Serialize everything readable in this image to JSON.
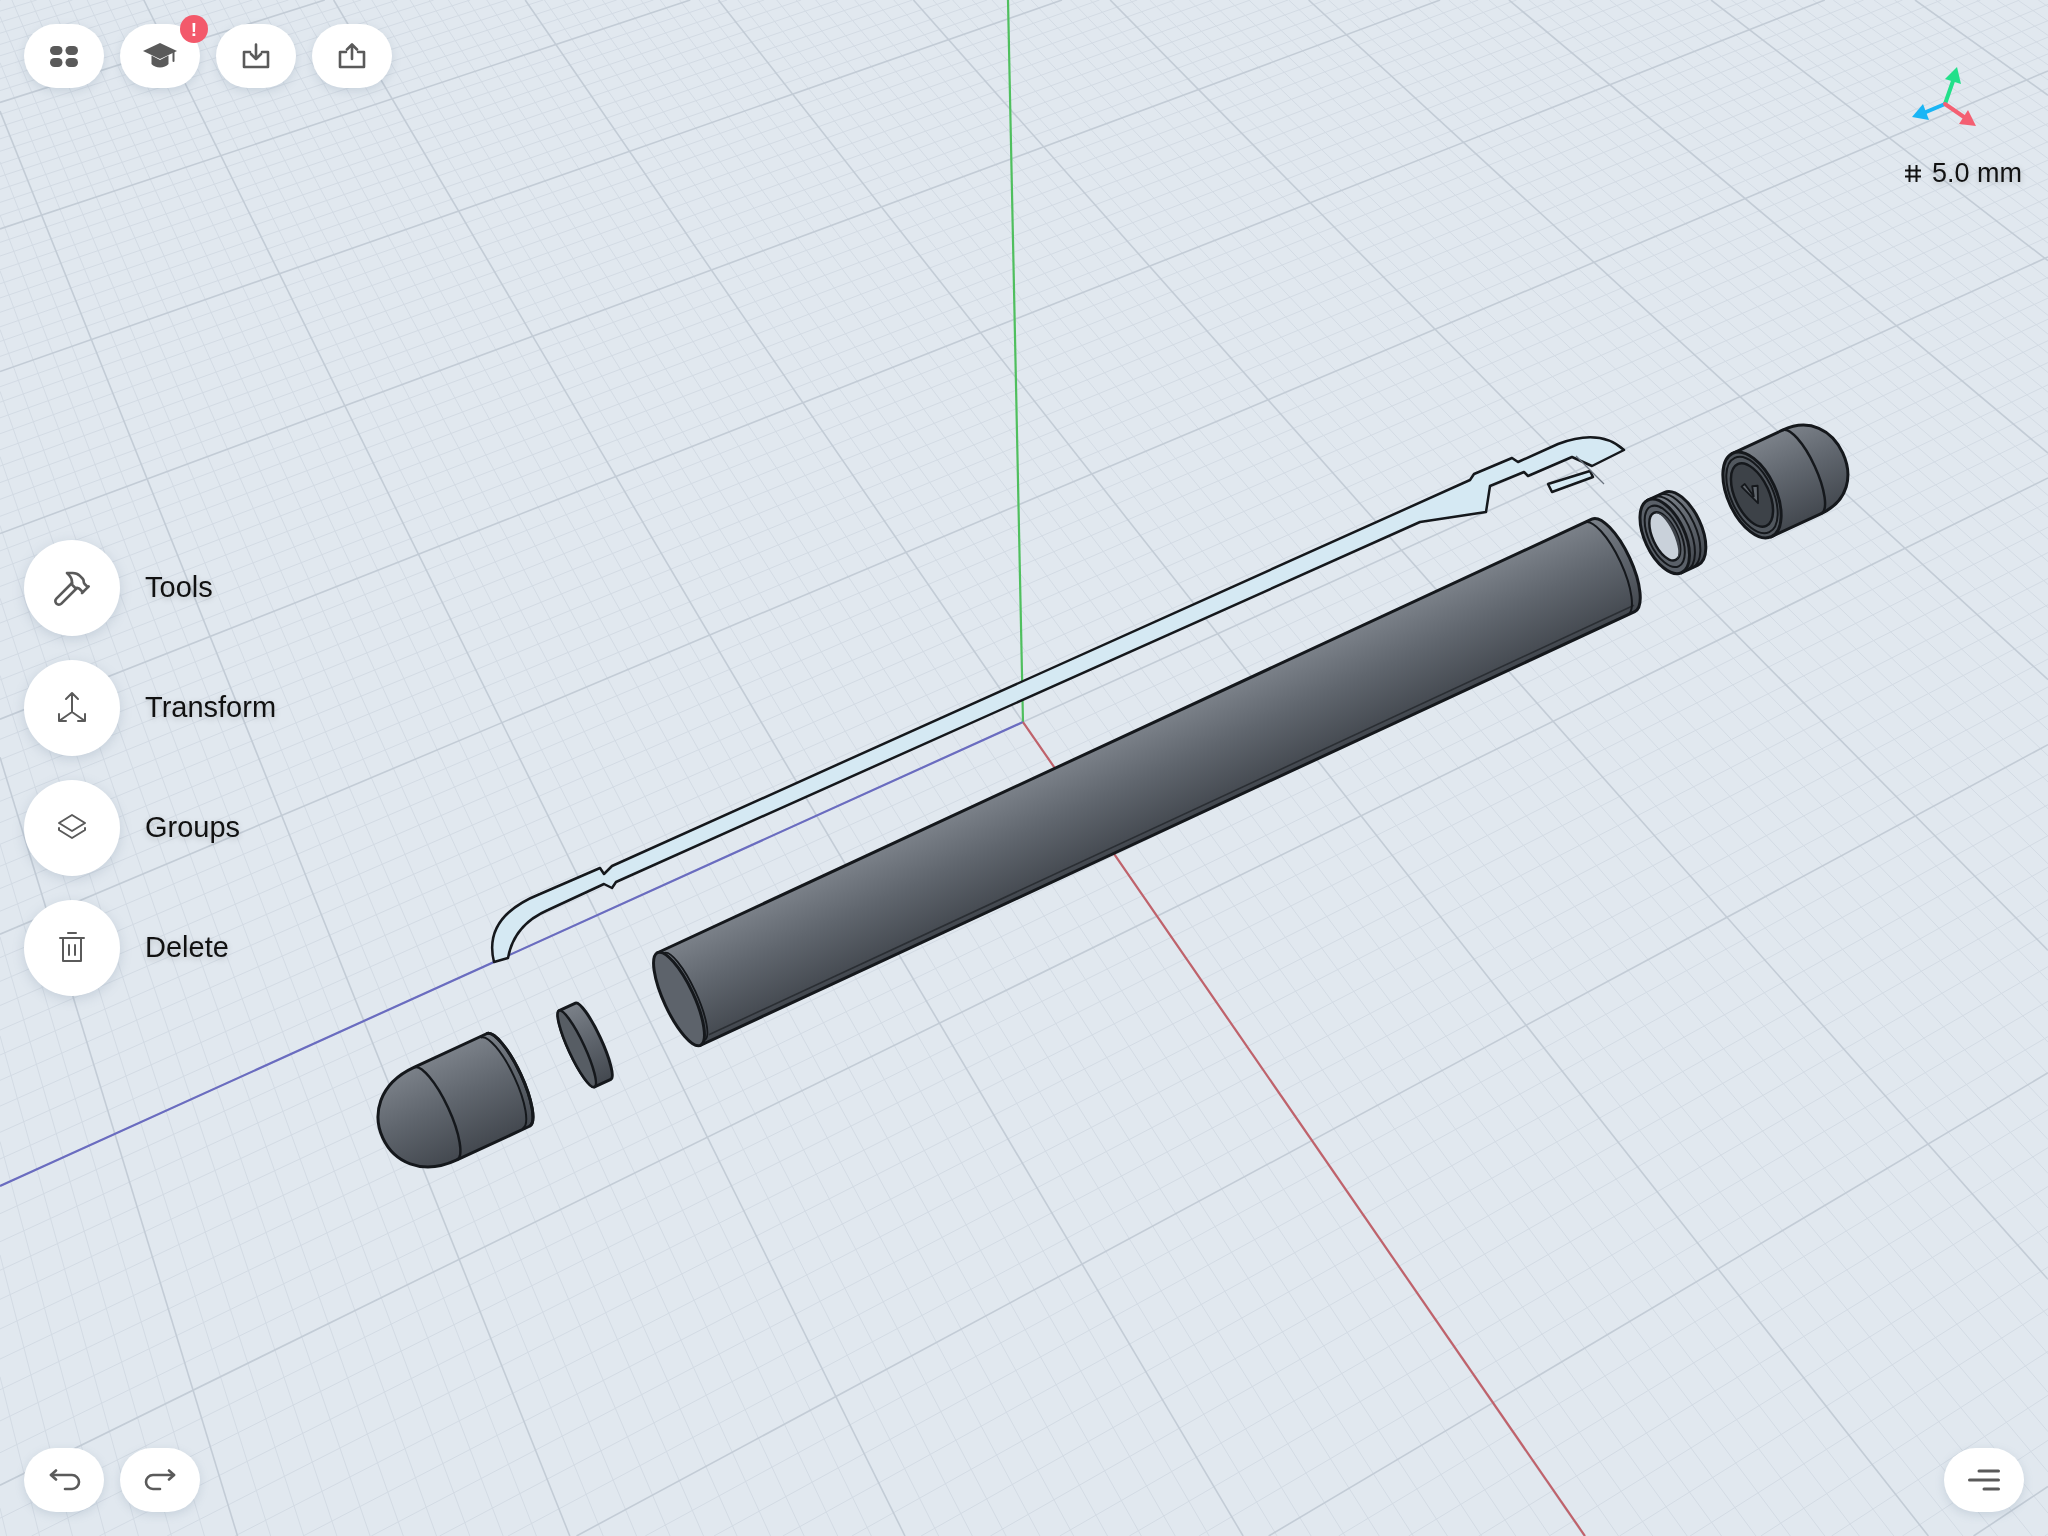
{
  "top_toolbar": [
    {
      "kind": "apps"
    },
    {
      "kind": "learn",
      "badge": "!"
    },
    {
      "kind": "import"
    },
    {
      "kind": "export"
    }
  ],
  "side_menu": [
    {
      "kind": "tools",
      "label": "Tools"
    },
    {
      "kind": "transform",
      "label": "Transform"
    },
    {
      "kind": "groups",
      "label": "Groups"
    },
    {
      "kind": "delete",
      "label": "Delete"
    }
  ],
  "grid_size_label": "5.0 mm",
  "history_buttons": [
    {
      "kind": "undo"
    },
    {
      "kind": "redo"
    }
  ],
  "bottom_right_buttons": [
    {
      "kind": "menu"
    }
  ]
}
